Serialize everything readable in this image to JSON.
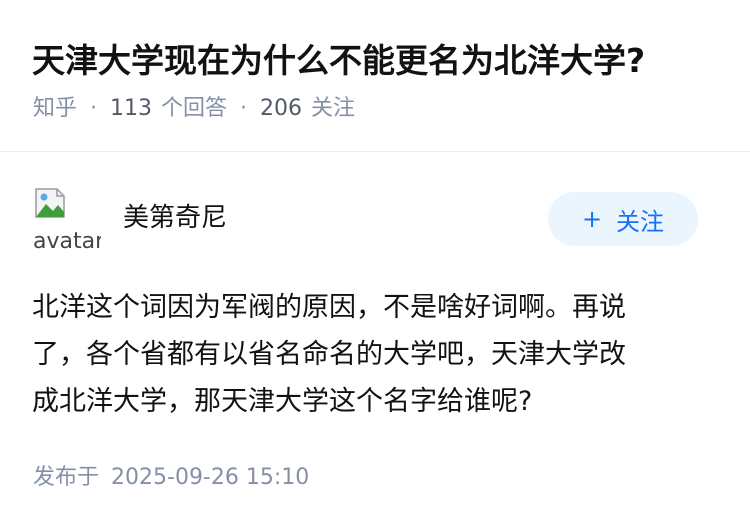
{
  "question": {
    "title": "天津大学现在为什么不能更名为北洋大学?",
    "source": "知乎",
    "answer_count": "113",
    "answer_label": "个回答",
    "follower_count": "206",
    "follower_label": "关注",
    "separator": "·"
  },
  "author": {
    "name": "美第奇尼",
    "avatar_alt": "avatar",
    "avatar_icon": "broken-image-icon",
    "follow_label": "关注",
    "follow_icon": "+"
  },
  "answer": {
    "lines": [
      "北洋这个词因为军阀的原因，不是啥好词啊。再说",
      "了，各个省都有以省名命名的大学吧，天津大学改",
      "成北洋大学，那天津大学这个名字给谁呢?"
    ]
  },
  "publish": {
    "label": "发布于",
    "datetime": "2025-09-26 15:10"
  },
  "colors": {
    "text": "#121212",
    "meta": "#8590a6",
    "accent": "#1772f6",
    "follow_bg": "#ebf5fd"
  }
}
